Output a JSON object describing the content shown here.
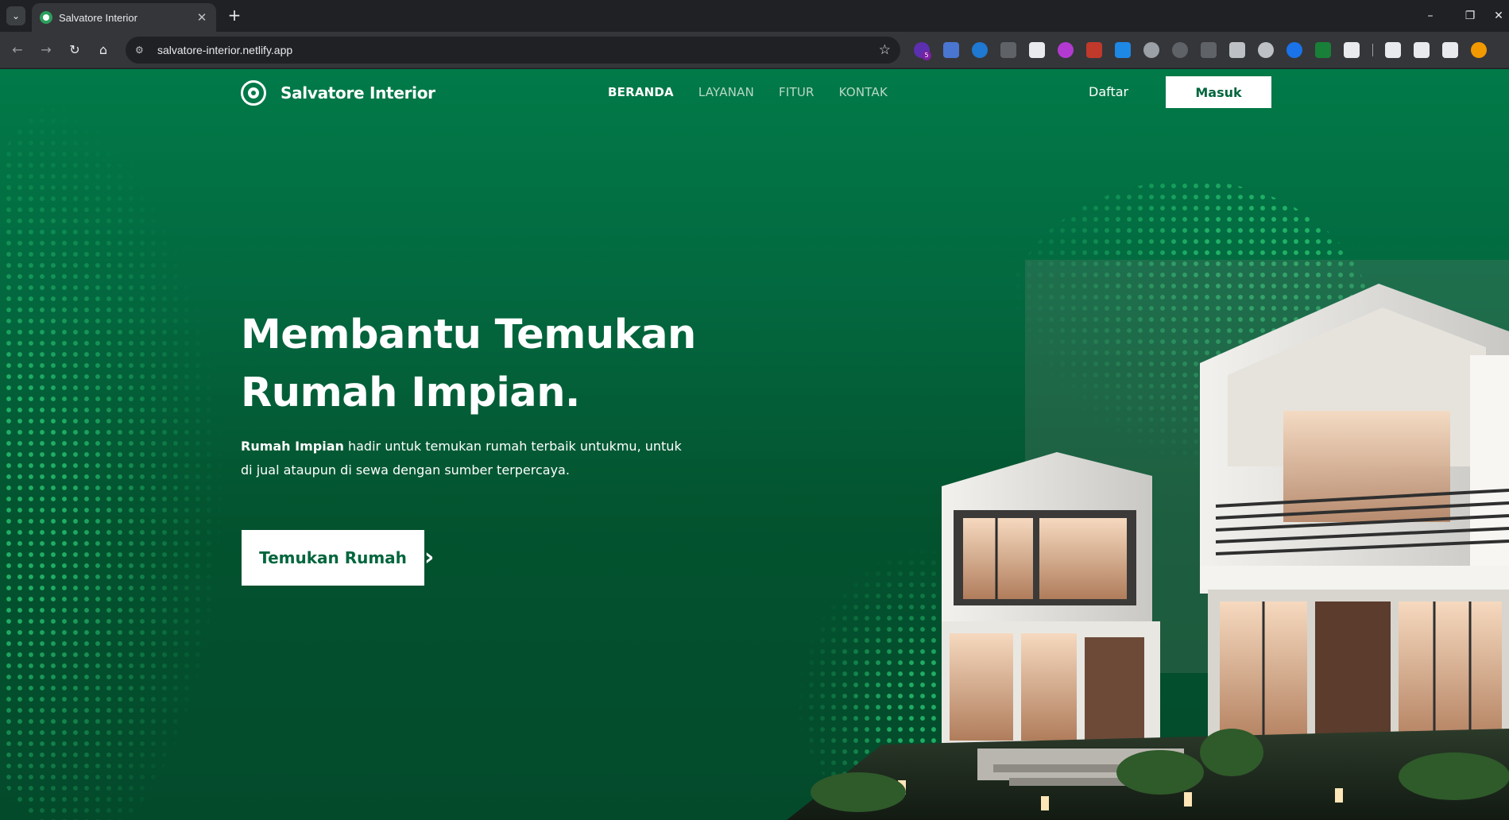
{
  "browser": {
    "tab_title": "Salvatore Interior",
    "url": "salvatore-interior.netlify.app",
    "extension_badge": "5"
  },
  "nav": {
    "brand": "Salvatore Interior",
    "menu": [
      "BERANDA",
      "LAYANAN",
      "FITUR",
      "KONTAK"
    ],
    "active_menu": "BERANDA",
    "register_label": "Daftar",
    "login_label": "Masuk"
  },
  "hero": {
    "title_line1": "Membantu Temukan",
    "title_line2": "Rumah Impian.",
    "desc_bold": "Rumah Impian",
    "desc_rest": " hadir untuk temukan rumah terbaik untukmu, untuk di jual ataupun di sewa dengan sumber terpercaya.",
    "cta_label": "Temukan Rumah"
  },
  "colors": {
    "brand_green": "#02663d",
    "bg_top": "#017a48",
    "bg_bottom": "#034a2b",
    "dot_green": "#26be6e"
  },
  "icons": [
    "tab-search-icon",
    "close-icon",
    "plus-icon",
    "back-icon",
    "forward-icon",
    "reload-icon",
    "home-icon",
    "tune-icon",
    "star-icon",
    "logo-icon",
    "chevron-right-icon"
  ]
}
